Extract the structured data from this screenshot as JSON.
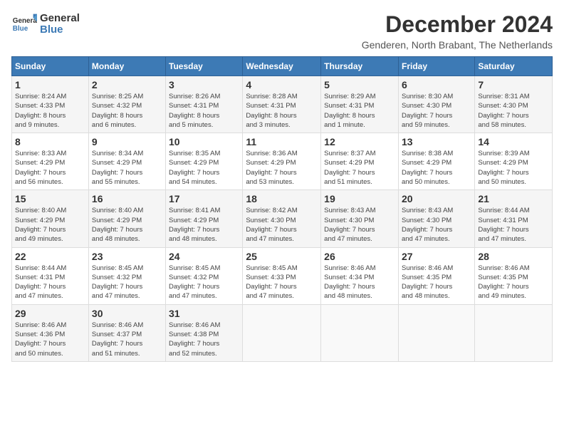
{
  "header": {
    "logo_text_line1": "General",
    "logo_text_line2": "Blue",
    "month_title": "December 2024",
    "location": "Genderen, North Brabant, The Netherlands"
  },
  "columns": [
    "Sunday",
    "Monday",
    "Tuesday",
    "Wednesday",
    "Thursday",
    "Friday",
    "Saturday"
  ],
  "weeks": [
    [
      {
        "day": "1",
        "info": "Sunrise: 8:24 AM\nSunset: 4:33 PM\nDaylight: 8 hours\nand 9 minutes."
      },
      {
        "day": "2",
        "info": "Sunrise: 8:25 AM\nSunset: 4:32 PM\nDaylight: 8 hours\nand 6 minutes."
      },
      {
        "day": "3",
        "info": "Sunrise: 8:26 AM\nSunset: 4:31 PM\nDaylight: 8 hours\nand 5 minutes."
      },
      {
        "day": "4",
        "info": "Sunrise: 8:28 AM\nSunset: 4:31 PM\nDaylight: 8 hours\nand 3 minutes."
      },
      {
        "day": "5",
        "info": "Sunrise: 8:29 AM\nSunset: 4:31 PM\nDaylight: 8 hours\nand 1 minute."
      },
      {
        "day": "6",
        "info": "Sunrise: 8:30 AM\nSunset: 4:30 PM\nDaylight: 7 hours\nand 59 minutes."
      },
      {
        "day": "7",
        "info": "Sunrise: 8:31 AM\nSunset: 4:30 PM\nDaylight: 7 hours\nand 58 minutes."
      }
    ],
    [
      {
        "day": "8",
        "info": "Sunrise: 8:33 AM\nSunset: 4:29 PM\nDaylight: 7 hours\nand 56 minutes."
      },
      {
        "day": "9",
        "info": "Sunrise: 8:34 AM\nSunset: 4:29 PM\nDaylight: 7 hours\nand 55 minutes."
      },
      {
        "day": "10",
        "info": "Sunrise: 8:35 AM\nSunset: 4:29 PM\nDaylight: 7 hours\nand 54 minutes."
      },
      {
        "day": "11",
        "info": "Sunrise: 8:36 AM\nSunset: 4:29 PM\nDaylight: 7 hours\nand 53 minutes."
      },
      {
        "day": "12",
        "info": "Sunrise: 8:37 AM\nSunset: 4:29 PM\nDaylight: 7 hours\nand 51 minutes."
      },
      {
        "day": "13",
        "info": "Sunrise: 8:38 AM\nSunset: 4:29 PM\nDaylight: 7 hours\nand 50 minutes."
      },
      {
        "day": "14",
        "info": "Sunrise: 8:39 AM\nSunset: 4:29 PM\nDaylight: 7 hours\nand 50 minutes."
      }
    ],
    [
      {
        "day": "15",
        "info": "Sunrise: 8:40 AM\nSunset: 4:29 PM\nDaylight: 7 hours\nand 49 minutes."
      },
      {
        "day": "16",
        "info": "Sunrise: 8:40 AM\nSunset: 4:29 PM\nDaylight: 7 hours\nand 48 minutes."
      },
      {
        "day": "17",
        "info": "Sunrise: 8:41 AM\nSunset: 4:29 PM\nDaylight: 7 hours\nand 48 minutes."
      },
      {
        "day": "18",
        "info": "Sunrise: 8:42 AM\nSunset: 4:30 PM\nDaylight: 7 hours\nand 47 minutes."
      },
      {
        "day": "19",
        "info": "Sunrise: 8:43 AM\nSunset: 4:30 PM\nDaylight: 7 hours\nand 47 minutes."
      },
      {
        "day": "20",
        "info": "Sunrise: 8:43 AM\nSunset: 4:30 PM\nDaylight: 7 hours\nand 47 minutes."
      },
      {
        "day": "21",
        "info": "Sunrise: 8:44 AM\nSunset: 4:31 PM\nDaylight: 7 hours\nand 47 minutes."
      }
    ],
    [
      {
        "day": "22",
        "info": "Sunrise: 8:44 AM\nSunset: 4:31 PM\nDaylight: 7 hours\nand 47 minutes."
      },
      {
        "day": "23",
        "info": "Sunrise: 8:45 AM\nSunset: 4:32 PM\nDaylight: 7 hours\nand 47 minutes."
      },
      {
        "day": "24",
        "info": "Sunrise: 8:45 AM\nSunset: 4:32 PM\nDaylight: 7 hours\nand 47 minutes."
      },
      {
        "day": "25",
        "info": "Sunrise: 8:45 AM\nSunset: 4:33 PM\nDaylight: 7 hours\nand 47 minutes."
      },
      {
        "day": "26",
        "info": "Sunrise: 8:46 AM\nSunset: 4:34 PM\nDaylight: 7 hours\nand 48 minutes."
      },
      {
        "day": "27",
        "info": "Sunrise: 8:46 AM\nSunset: 4:35 PM\nDaylight: 7 hours\nand 48 minutes."
      },
      {
        "day": "28",
        "info": "Sunrise: 8:46 AM\nSunset: 4:35 PM\nDaylight: 7 hours\nand 49 minutes."
      }
    ],
    [
      {
        "day": "29",
        "info": "Sunrise: 8:46 AM\nSunset: 4:36 PM\nDaylight: 7 hours\nand 50 minutes."
      },
      {
        "day": "30",
        "info": "Sunrise: 8:46 AM\nSunset: 4:37 PM\nDaylight: 7 hours\nand 51 minutes."
      },
      {
        "day": "31",
        "info": "Sunrise: 8:46 AM\nSunset: 4:38 PM\nDaylight: 7 hours\nand 52 minutes."
      },
      null,
      null,
      null,
      null
    ]
  ]
}
